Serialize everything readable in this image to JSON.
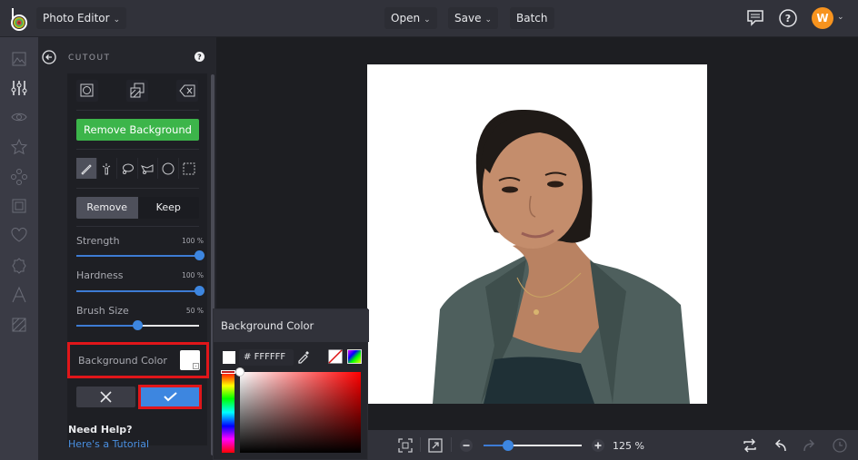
{
  "topbar": {
    "app_menu_label": "Photo Editor",
    "menu": [
      {
        "label": "Open",
        "has_dropdown": true
      },
      {
        "label": "Save",
        "has_dropdown": true
      },
      {
        "label": "Batch",
        "has_dropdown": false
      }
    ],
    "icons": [
      "feedback-icon",
      "help-icon"
    ],
    "avatar_initial": "W",
    "avatar_color": "#f7931e"
  },
  "left_rail": {
    "items": [
      "image-manager",
      "adjustments",
      "eye",
      "star",
      "graphics",
      "frames",
      "heart",
      "badge",
      "text",
      "texture"
    ],
    "active": "adjustments"
  },
  "panel": {
    "title": "CUTOUT",
    "top_tools": [
      "cutout-shape",
      "layer-copy",
      "clear-eraser"
    ],
    "remove_bg_label": "Remove Background",
    "brush_tools": [
      "brush",
      "magic-wand",
      "lasso",
      "polygon-lasso",
      "ellipse",
      "rectangle"
    ],
    "active_brush_tool": "brush",
    "mode": {
      "options": [
        "Remove",
        "Keep"
      ],
      "selected": "Remove"
    },
    "sliders": [
      {
        "label": "Strength",
        "value": 100,
        "unit": "%"
      },
      {
        "label": "Hardness",
        "value": 100,
        "unit": "%"
      },
      {
        "label": "Brush Size",
        "value": 50,
        "unit": "%"
      }
    ],
    "background_color_label": "Background Color",
    "background_color": "#FFFFFF",
    "cancel_label": "✕",
    "apply_label": "✓",
    "need_help": "Need Help?",
    "tutorial_link": "Here's a Tutorial"
  },
  "color_picker": {
    "title": "Background Color",
    "hash": "#",
    "hex_value": "FFFFFF",
    "hue": 0
  },
  "bottombar": {
    "zoom_percent": 125,
    "zoom_text": "125 %",
    "zoom_slider_fraction": 0.25
  }
}
